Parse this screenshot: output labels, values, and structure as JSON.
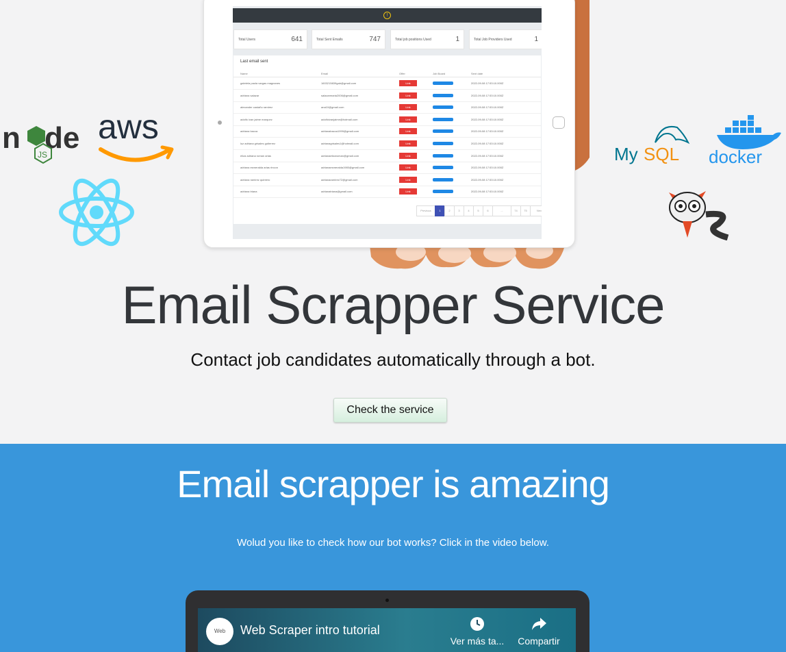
{
  "hero": {
    "title": "Email Scrapper Service",
    "subtitle": "Contact job candidates automatically through a bot.",
    "cta_label": "Check the service"
  },
  "dashboard_preview": {
    "stats": [
      {
        "label": "Total Users",
        "value": "641"
      },
      {
        "label": "Total Sent Emails",
        "value": "747"
      },
      {
        "label": "Total job positions Used",
        "value": "1"
      },
      {
        "label": "Total Job Providers Used",
        "value": "1"
      }
    ],
    "table_title": "Last email sent",
    "columns": [
      "Name",
      "Email",
      "Offer",
      "Job Board",
      "Sent date"
    ],
    "rows": [
      {
        "name": "gabriela paola vargas magnanes",
        "email": "1603215839gab@gmail.com",
        "offer": "Link",
        "date": "2022-09-08 17:53:10.000Z"
      },
      {
        "name": "adriana salazar",
        "email": "salazarmaria2006@gmail.com",
        "offer": "Link",
        "date": "2022-09-08 17:53:10.000Z"
      },
      {
        "name": "alexander castaño ramirez",
        "email": "ana10@gmail.com",
        "offer": "Link",
        "date": "2022-09-08 17:53:10.000Z"
      },
      {
        "name": "adolfo ivan jaime marquez",
        "email": "adolfoivanjaime@hotmail.com",
        "offer": "Link",
        "date": "2022-09-08 17:53:10.000Z"
      },
      {
        "name": "adriana bacca",
        "email": "adrianabacca1999@gmail.com",
        "offer": "Link",
        "date": "2022-09-08 17:53:10.000Z"
      },
      {
        "name": "luz adriana grisales gutierrez",
        "email": "adrianagrisales1@hotmail.com",
        "offer": "Link",
        "date": "2022-09-08 17:53:10.000Z"
      },
      {
        "name": "eliza adriana roman arias",
        "email": "adrianaelizaroman@gmail.com",
        "offer": "Link",
        "date": "2022-09-08 17:53:10.000Z"
      },
      {
        "name": "adriana esmeralda arias rincon",
        "email": "adrianaesmeralda1980@gmail.com",
        "offer": "Link",
        "date": "2022-09-08 17:53:10.000Z"
      },
      {
        "name": "adriana ramirez quintero",
        "email": "adrianaramirez72@gmail.com",
        "offer": "Link",
        "date": "2022-09-08 17:53:10.000Z"
      },
      {
        "name": "adriana triana",
        "email": "adrianatriana@gmail.com",
        "offer": "Link",
        "date": "2022-09-08 17:53:10.000Z"
      }
    ],
    "pagination": [
      "Previous",
      "1",
      "2",
      "3",
      "4",
      "5",
      "6",
      "...",
      "74",
      "75",
      "Next"
    ]
  },
  "logos": {
    "node": "Node.js",
    "aws": "aws",
    "react": "React",
    "mysql": "MySQL",
    "docker": "docker",
    "sails": "Sails.js"
  },
  "band": {
    "title": "Email scrapper is amazing",
    "subtitle": "Wolud you like to check how our bot works? Click in the video below."
  },
  "video": {
    "channel": "Web Scraper",
    "title": "Web Scraper intro tutorial",
    "watch_later": "Ver más ta...",
    "share": "Compartir"
  },
  "colors": {
    "hero_bg": "#f3f3f4",
    "band_bg": "#3996db",
    "node_green": "#3e863d",
    "aws_orange": "#ff9900",
    "react_cyan": "#61dafb",
    "mysql_blue": "#00758f",
    "mysql_orange": "#f29111",
    "docker_blue": "#2496ed"
  }
}
